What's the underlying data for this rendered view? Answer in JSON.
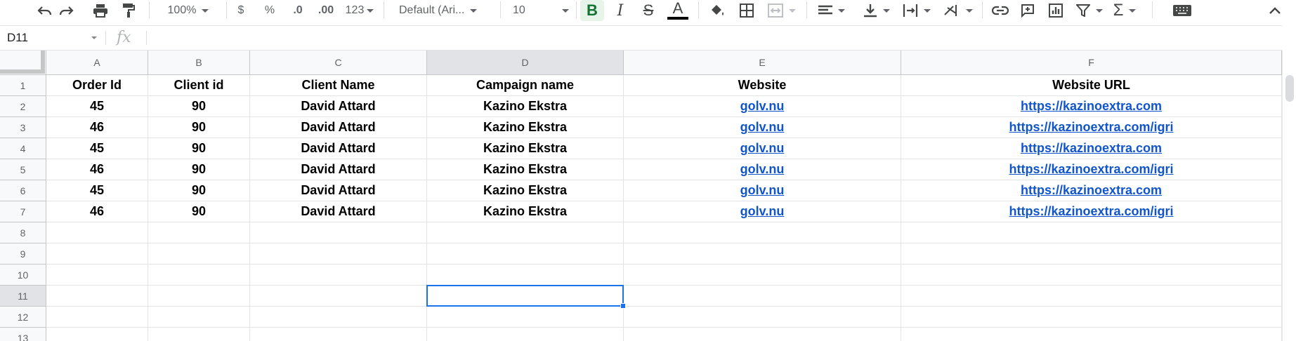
{
  "toolbar": {
    "zoom": "100%",
    "currency_label": "$",
    "percent_label": "%",
    "decrease_decimals_label": ".0",
    "increase_decimals_label": ".00",
    "format_label": "123",
    "font_family": "Default (Ari...",
    "font_size": "10",
    "bold_label": "B",
    "italic_label": "I",
    "strike_label": "S",
    "text_color_label": "A",
    "icons": [
      "undo-icon",
      "redo-icon",
      "print-icon",
      "paint-format-icon",
      "bold-icon",
      "italic-icon",
      "strikethrough-icon",
      "text-color-icon",
      "fill-color-icon",
      "borders-icon",
      "merge-cells-icon",
      "horizontal-align-icon",
      "vertical-align-icon",
      "text-wrapping-icon",
      "text-rotation-icon",
      "link-icon",
      "comment-icon",
      "chart-icon",
      "filter-icon",
      "functions-icon",
      "keyboard-icon",
      "collapse-icon"
    ],
    "bold_active_color": "#137333",
    "text_color_bar": "#000000"
  },
  "formula_bar": {
    "name_box": "D11",
    "fx_label": "fx",
    "formula_value": ""
  },
  "sheet": {
    "columns": [
      "A",
      "B",
      "C",
      "D",
      "E",
      "F"
    ],
    "rows": [
      "1",
      "2",
      "3",
      "4",
      "5",
      "6",
      "7",
      "8",
      "9",
      "10",
      "11",
      "12",
      "13"
    ],
    "active_column": "D",
    "active_row": "11",
    "data": [
      [
        "Order Id",
        "Client id",
        "Client Name",
        "Campaign name",
        "Website",
        "Website URL"
      ],
      [
        "45",
        "90",
        "David Attard",
        "Kazino Ekstra",
        "golv.nu",
        "https://kazinoextra.com"
      ],
      [
        "46",
        "90",
        "David Attard",
        "Kazino Ekstra",
        "golv.nu",
        "https://kazinoextra.com/igri"
      ],
      [
        "45",
        "90",
        "David Attard",
        "Kazino Ekstra",
        "golv.nu",
        "https://kazinoextra.com"
      ],
      [
        "46",
        "90",
        "David Attard",
        "Kazino Ekstra",
        "golv.nu",
        "https://kazinoextra.com/igri"
      ],
      [
        "45",
        "90",
        "David Attard",
        "Kazino Ekstra",
        "golv.nu",
        "https://kazinoextra.com"
      ],
      [
        "46",
        "90",
        "David Attard",
        "Kazino Ekstra",
        "golv.nu",
        "https://kazinoextra.com/igri"
      ]
    ],
    "link_color": "#1155cc",
    "selection_color": "#1a73e8"
  }
}
